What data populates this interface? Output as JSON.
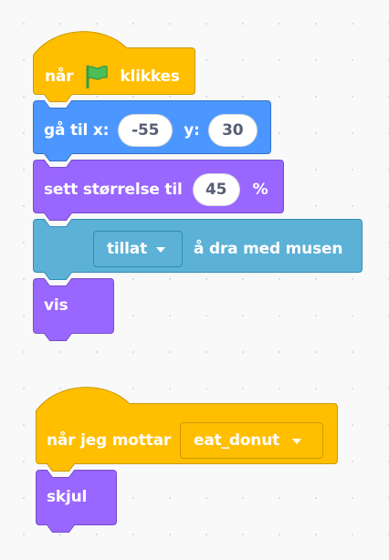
{
  "colors": {
    "events": "#FFBF00",
    "events_border": "#CC9900",
    "motion": "#4C97FF",
    "motion_border": "#3373CC",
    "looks": "#9966FF",
    "looks_border": "#774DCB",
    "sensing": "#5CB1D6",
    "sensing_border": "#2E8EB8",
    "flag": "#4CBF56"
  },
  "script1": {
    "when_flag": {
      "text_before": "når",
      "icon": "green-flag-icon",
      "text_after": "klikkes"
    },
    "goto": {
      "label_x": "gå til x:",
      "x_value": "-55",
      "label_y": "y:",
      "y_value": "30"
    },
    "set_size": {
      "label": "sett størrelse til",
      "value": "45",
      "unit": "%"
    },
    "drag_mode": {
      "selected": "tillat",
      "suffix": "å dra med musen"
    },
    "show": {
      "label": "vis"
    }
  },
  "script2": {
    "when_receive": {
      "label": "når jeg mottar",
      "message": "eat_donut"
    },
    "hide": {
      "label": "skjul"
    }
  }
}
